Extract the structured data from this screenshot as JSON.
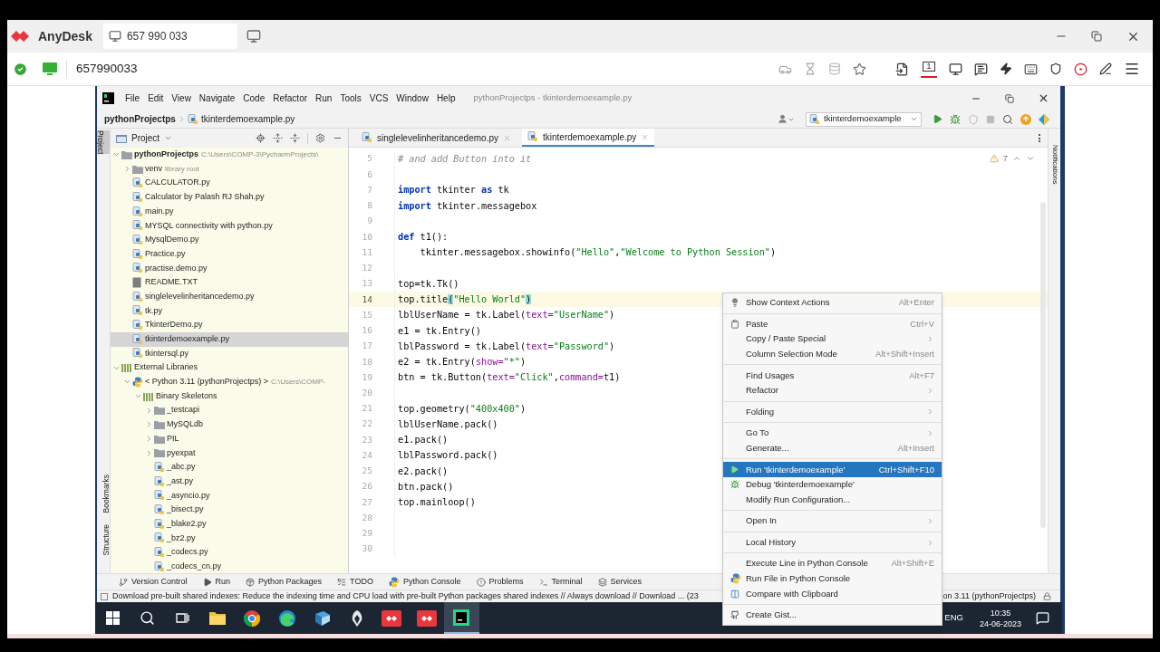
{
  "anydesk": {
    "app_name": "AnyDesk",
    "tab": {
      "label": "657 990 033"
    },
    "address": "657990033",
    "display_number": "1"
  },
  "pycharm": {
    "menu": [
      "File",
      "Edit",
      "View",
      "Navigate",
      "Code",
      "Refactor",
      "Run",
      "Tools",
      "VCS",
      "Window",
      "Help"
    ],
    "window_title": "pythonProjectps - tkinterdemoexample.py",
    "breadcrumbs": [
      "pythonProjectps",
      "tkinterdemoexample.py"
    ],
    "run_config": "tkinterdemoexample",
    "left_stripe": [
      {
        "label": "Project",
        "selected": true
      },
      {
        "label": "Bookmarks",
        "selected": false
      },
      {
        "label": "Structure",
        "selected": false
      }
    ],
    "right_stripe": [
      "Notifications"
    ],
    "project_panel": {
      "title": "Project",
      "tree": [
        {
          "label": "pythonProjectps",
          "hint": "C:\\Users\\COMP-3\\PycharmProjects\\",
          "kind": "project",
          "expanded": true,
          "selected": false,
          "children": [
            {
              "label": "venv",
              "hint": "library root",
              "kind": "folder",
              "expanded": false,
              "selected": false
            },
            {
              "label": "CALCULATOR.py",
              "kind": "py",
              "selected": false
            },
            {
              "label": "Calculator by Palash RJ Shah.py",
              "kind": "py",
              "selected": false
            },
            {
              "label": "main.py",
              "kind": "py",
              "selected": false
            },
            {
              "label": "MYSQL connectivity with python.py",
              "kind": "py",
              "selected": false
            },
            {
              "label": "MysqlDemo.py",
              "kind": "py",
              "selected": false
            },
            {
              "label": "Practice.py",
              "kind": "py",
              "selected": false
            },
            {
              "label": "practise.demo.py",
              "kind": "py",
              "selected": false
            },
            {
              "label": "README.TXT",
              "kind": "txt",
              "selected": false
            },
            {
              "label": "singlelevelinheritancedemo.py",
              "kind": "py",
              "selected": false
            },
            {
              "label": "tk.py",
              "kind": "py",
              "selected": false
            },
            {
              "label": "TkinterDemo.py",
              "kind": "py",
              "selected": false
            },
            {
              "label": "tkinterdemoexample.py",
              "kind": "py",
              "selected": true
            },
            {
              "label": "tkintersql.py",
              "kind": "py",
              "selected": false
            }
          ]
        },
        {
          "label": "External Libraries",
          "kind": "library",
          "expanded": true,
          "selected": false,
          "children": [
            {
              "label": "< Python 3.11 (pythonProjectps) >",
              "hint": "C:\\Users\\COMP-",
              "kind": "python",
              "expanded": true,
              "selected": false,
              "children": [
                {
                  "label": "Binary Skeletons",
                  "kind": "library",
                  "expanded": true,
                  "selected": false,
                  "children": [
                    {
                      "label": "_testcapi",
                      "kind": "folder",
                      "expanded": false,
                      "selected": false
                    },
                    {
                      "label": "MySQLdb",
                      "kind": "folder",
                      "expanded": false,
                      "selected": false
                    },
                    {
                      "label": "PIL",
                      "kind": "folder",
                      "expanded": false,
                      "selected": false
                    },
                    {
                      "label": "pyexpat",
                      "kind": "folder",
                      "expanded": false,
                      "selected": false
                    },
                    {
                      "label": "_abc.py",
                      "kind": "py",
                      "selected": false
                    },
                    {
                      "label": "_ast.py",
                      "kind": "py",
                      "selected": false
                    },
                    {
                      "label": "_asyncio.py",
                      "kind": "py",
                      "selected": false
                    },
                    {
                      "label": "_bisect.py",
                      "kind": "py",
                      "selected": false
                    },
                    {
                      "label": "_blake2.py",
                      "kind": "py",
                      "selected": false
                    },
                    {
                      "label": "_bz2.py",
                      "kind": "py",
                      "selected": false
                    },
                    {
                      "label": "_codecs.py",
                      "kind": "py",
                      "selected": false
                    },
                    {
                      "label": "_codecs_cn.py",
                      "kind": "py",
                      "selected": false
                    }
                  ]
                }
              ]
            }
          ]
        }
      ]
    },
    "editor": {
      "tabs": [
        {
          "label": "singlelevelinheritancedemo.py",
          "selected": false
        },
        {
          "label": "tkinterdemoexample.py",
          "selected": true
        }
      ],
      "warnings": "7",
      "lines": [
        {
          "number": "5",
          "current": false,
          "tokens": [
            {
              "kind": "comment",
              "text": "# and add Button into it"
            }
          ]
        },
        {
          "number": "6",
          "current": false
        },
        {
          "number": "7",
          "current": false,
          "tokens": [
            {
              "kind": "kw",
              "text": "import"
            },
            {
              "kind": "plain",
              "text": " tkinter "
            },
            {
              "kind": "kw",
              "text": "as"
            },
            {
              "kind": "plain",
              "text": " tk"
            }
          ]
        },
        {
          "number": "8",
          "current": false,
          "tokens": [
            {
              "kind": "kw",
              "text": "import"
            },
            {
              "kind": "plain",
              "text": " tkinter.messagebox"
            }
          ]
        },
        {
          "number": "9",
          "current": false
        },
        {
          "number": "10",
          "current": false,
          "tokens": [
            {
              "kind": "kw",
              "text": "def"
            },
            {
              "kind": "plain",
              "text": " t1():"
            }
          ]
        },
        {
          "number": "11",
          "current": false,
          "tokens": [
            {
              "kind": "plain",
              "text": "    tkinter.messagebox.showinfo("
            },
            {
              "kind": "str",
              "text": "\"Hello\""
            },
            {
              "kind": "plain",
              "text": ","
            },
            {
              "kind": "str",
              "text": "\"Welcome to Python Session\""
            },
            {
              "kind": "plain",
              "text": ")"
            }
          ]
        },
        {
          "number": "12",
          "current": false
        },
        {
          "number": "13",
          "current": false,
          "tokens": [
            {
              "kind": "plain",
              "text": "top=tk.Tk()"
            }
          ]
        },
        {
          "number": "14",
          "current": true,
          "tokens": [
            {
              "kind": "plain",
              "text": "top.title"
            },
            {
              "kind": "match",
              "text": "("
            },
            {
              "kind": "str",
              "text": "\"Hello World\""
            },
            {
              "kind": "match",
              "text": ")"
            }
          ]
        },
        {
          "number": "15",
          "current": false,
          "tokens": [
            {
              "kind": "plain",
              "text": "lblUserName = tk.Label("
            },
            {
              "kind": "param",
              "text": "text="
            },
            {
              "kind": "str",
              "text": "\"UserName\""
            },
            {
              "kind": "plain",
              "text": ")"
            }
          ]
        },
        {
          "number": "16",
          "current": false,
          "tokens": [
            {
              "kind": "plain",
              "text": "e1 = tk.Entry()"
            }
          ]
        },
        {
          "number": "17",
          "current": false,
          "tokens": [
            {
              "kind": "plain",
              "text": "lblPassword = tk.Label("
            },
            {
              "kind": "param",
              "text": "text="
            },
            {
              "kind": "str",
              "text": "\"Password\""
            },
            {
              "kind": "plain",
              "text": ")"
            }
          ]
        },
        {
          "number": "18",
          "current": false,
          "tokens": [
            {
              "kind": "plain",
              "text": "e2 = tk.Entry("
            },
            {
              "kind": "param",
              "text": "show="
            },
            {
              "kind": "str",
              "text": "\"*\""
            },
            {
              "kind": "plain",
              "text": ")"
            }
          ]
        },
        {
          "number": "19",
          "current": false,
          "tokens": [
            {
              "kind": "plain",
              "text": "btn = tk.Button("
            },
            {
              "kind": "param",
              "text": "text="
            },
            {
              "kind": "str",
              "text": "\"Click\""
            },
            {
              "kind": "plain",
              "text": ","
            },
            {
              "kind": "param",
              "text": "command="
            },
            {
              "kind": "plain",
              "text": "t1)"
            }
          ]
        },
        {
          "number": "20",
          "current": false
        },
        {
          "number": "21",
          "current": false,
          "tokens": [
            {
              "kind": "plain",
              "text": "top.geometry("
            },
            {
              "kind": "str",
              "text": "\"400x400\""
            },
            {
              "kind": "plain",
              "text": ")"
            }
          ]
        },
        {
          "number": "22",
          "current": false,
          "tokens": [
            {
              "kind": "plain",
              "text": "lblUserName.pack()"
            }
          ]
        },
        {
          "number": "23",
          "current": false,
          "tokens": [
            {
              "kind": "plain",
              "text": "e1.pack()"
            }
          ]
        },
        {
          "number": "24",
          "current": false,
          "tokens": [
            {
              "kind": "plain",
              "text": "lblPassword.pack()"
            }
          ]
        },
        {
          "number": "25",
          "current": false,
          "tokens": [
            {
              "kind": "plain",
              "text": "e2.pack()"
            }
          ]
        },
        {
          "number": "26",
          "current": false,
          "tokens": [
            {
              "kind": "plain",
              "text": "btn.pack()"
            }
          ]
        },
        {
          "number": "27",
          "current": false,
          "tokens": [
            {
              "kind": "plain",
              "text": "top.mainloop()"
            }
          ]
        },
        {
          "number": "28",
          "current": false
        },
        {
          "number": "29",
          "current": false
        },
        {
          "number": "30",
          "current": false
        }
      ]
    },
    "tool_windows": [
      {
        "label": "Version Control",
        "kind": "vcs"
      },
      {
        "label": "Run",
        "kind": "run"
      },
      {
        "label": "Python Packages",
        "kind": "packages"
      },
      {
        "label": "TODO",
        "kind": "todo"
      },
      {
        "label": "Python Console",
        "kind": "console"
      },
      {
        "label": "Problems",
        "kind": "problems"
      },
      {
        "label": "Terminal",
        "kind": "terminal"
      },
      {
        "label": "Services",
        "kind": "services"
      }
    ],
    "status": {
      "message": "Download pre-built shared indexes: Reduce the indexing time and CPU load with pre-built Python packages shared indexes // Always download // Download ... (23",
      "interpreter": "on 3.11 (pythonProjectps)"
    }
  },
  "context_menu": {
    "groups": [
      [
        {
          "label": "Show Context Actions",
          "shortcut": "Alt+Enter",
          "kind": "bulb",
          "submenu": false,
          "selected": false
        }
      ],
      [
        {
          "label": "Paste",
          "shortcut": "Ctrl+V",
          "kind": "clipboard",
          "submenu": false,
          "selected": false
        },
        {
          "label": "Copy / Paste Special",
          "kind": "plain",
          "submenu": true,
          "selected": false
        },
        {
          "label": "Column Selection Mode",
          "shortcut": "Alt+Shift+Insert",
          "kind": "plain",
          "submenu": false,
          "selected": false
        }
      ],
      [
        {
          "label": "Find Usages",
          "shortcut": "Alt+F7",
          "kind": "plain",
          "submenu": false,
          "selected": false
        },
        {
          "label": "Refactor",
          "kind": "plain",
          "submenu": true,
          "selected": false
        }
      ],
      [
        {
          "label": "Folding",
          "kind": "plain",
          "submenu": true,
          "selected": false
        }
      ],
      [
        {
          "label": "Go To",
          "kind": "plain",
          "submenu": true,
          "selected": false
        },
        {
          "label": "Generate...",
          "shortcut": "Alt+Insert",
          "kind": "plain",
          "submenu": false,
          "selected": false
        }
      ],
      [
        {
          "label": "Run 'tkinterdemoexample'",
          "shortcut": "Ctrl+Shift+F10",
          "kind": "run",
          "submenu": false,
          "selected": true
        },
        {
          "label": "Debug 'tkinterdemoexample'",
          "kind": "debug",
          "submenu": false,
          "selected": false
        },
        {
          "label": "Modify Run Configuration...",
          "kind": "plain",
          "submenu": false,
          "selected": false
        }
      ],
      [
        {
          "label": "Open In",
          "kind": "plain",
          "submenu": true,
          "selected": false
        }
      ],
      [
        {
          "label": "Local History",
          "kind": "plain",
          "submenu": true,
          "selected": false
        }
      ],
      [
        {
          "label": "Execute Line in Python Console",
          "shortcut": "Alt+Shift+E",
          "kind": "plain",
          "submenu": false,
          "selected": false
        },
        {
          "label": "Run File in Python Console",
          "kind": "python",
          "submenu": false,
          "selected": false
        },
        {
          "label": "Compare with Clipboard",
          "kind": "compare",
          "submenu": false,
          "selected": false
        }
      ],
      [
        {
          "label": "Create Gist...",
          "kind": "github",
          "submenu": false,
          "selected": false
        }
      ]
    ]
  },
  "taskbar": {
    "items": [
      {
        "kind": "start",
        "selected": false
      },
      {
        "kind": "search",
        "selected": false
      },
      {
        "kind": "taskview",
        "selected": false
      },
      {
        "kind": "explorer",
        "selected": false
      },
      {
        "kind": "chrome",
        "selected": false
      },
      {
        "kind": "edge",
        "selected": false
      },
      {
        "kind": "app",
        "selected": false
      },
      {
        "kind": "bird",
        "selected": false
      },
      {
        "kind": "anydesk",
        "selected": false
      },
      {
        "kind": "anydesk",
        "selected": false
      },
      {
        "kind": "pycharm",
        "selected": true
      }
    ],
    "tray": {
      "language": "ENG",
      "time": "10:35",
      "date": "24-06-2023"
    }
  }
}
